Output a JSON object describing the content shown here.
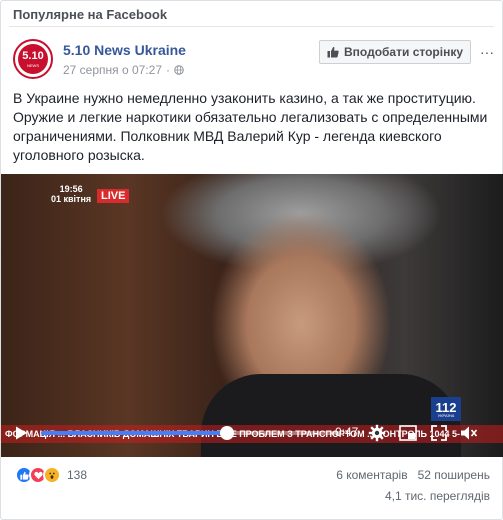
{
  "header": {
    "title": "Популярне на Facebook"
  },
  "post": {
    "page_name": "5.10 News Ukraine",
    "logo_text": "5.10",
    "logo_sub": "NEWS",
    "timestamp": "27 серпня о 07:27",
    "separator": "·",
    "like_page_label": "Вподобати сторінку",
    "more_label": "···",
    "text": "В Украине нужно немедленно узаконить казино, а так же проституцию. Оружие и легкие наркотики обязательно легализовать с определенными ограничениями. Полковник МВД Валерий Кур - легенда киевского уголовного розыска."
  },
  "video": {
    "tv_time": "19:56",
    "tv_date": "01 квітня",
    "live_label": "LIVE",
    "ticker": "ФОРМАЦІЯ  ...  ВЛАСНИКІВ ДОМАШНІХ ТВАРИН ВЖЕ ПРОБЛЕМ З ТРАНСПОРТОМ  ...  КОНТРОЛЬ 1044  5-",
    "channel_number": "112",
    "channel_sub": "УКРАЇНА",
    "time_remaining": "-0:47",
    "progress": 0.62
  },
  "footer": {
    "reaction_count": "138",
    "comments": "6 коментарів",
    "shares": "52 поширень",
    "views": "4,1 тис. переглядів"
  },
  "colors": {
    "link": "#365899",
    "progress": "#4080ff",
    "like": "#2078f4",
    "love": "#f33e58",
    "wow": "#f7b125",
    "live": "#d92b2b"
  }
}
